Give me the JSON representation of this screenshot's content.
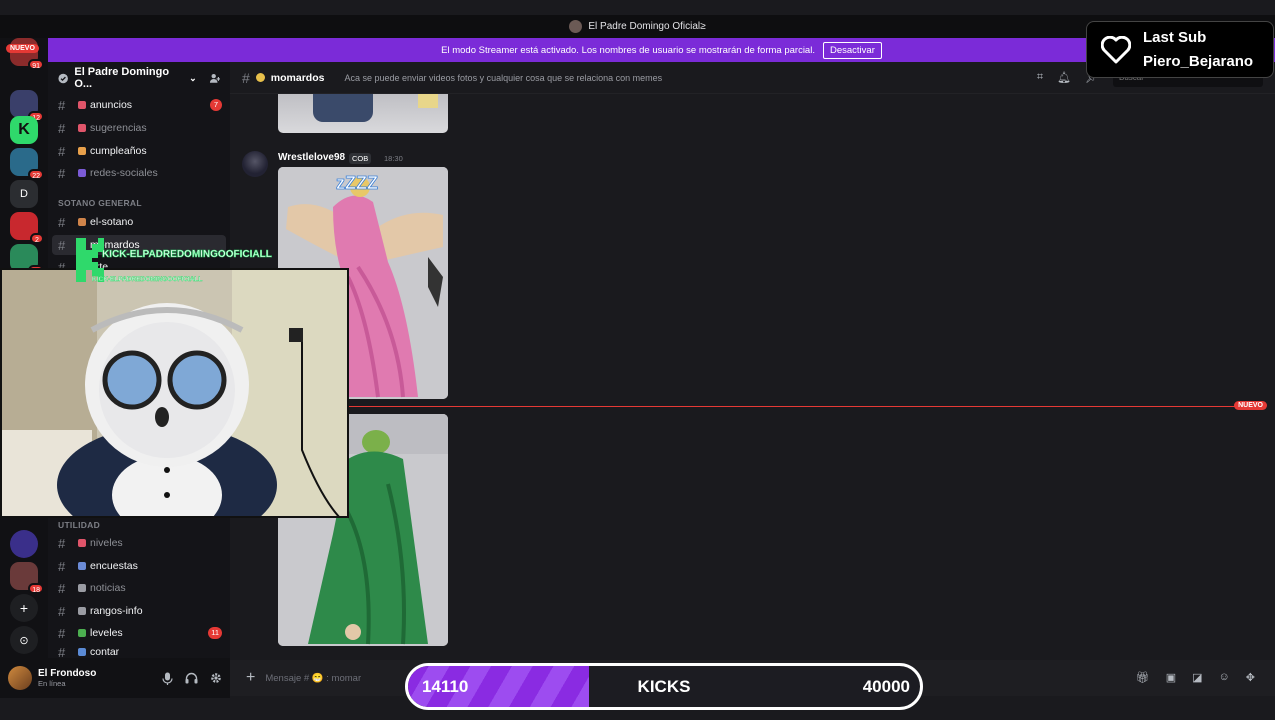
{
  "window": {
    "title": "El Padre Domingo Oficial≥"
  },
  "banner": {
    "text": "El modo Streamer está activado. Los nombres de usuario se mostrarán de forma parcial.",
    "button": "Desactivar"
  },
  "rail": {
    "top_badge": "NUEVO",
    "items": [
      {
        "label": "",
        "badge": "91"
      },
      {
        "label": "",
        "badge": "12"
      },
      {
        "label": "K",
        "badge": ""
      },
      {
        "label": "",
        "badge": "22"
      },
      {
        "label": "D",
        "badge": ""
      },
      {
        "label": "",
        "badge": "2"
      },
      {
        "label": "",
        "badge": "22"
      },
      {
        "label": "",
        "badge": ""
      },
      {
        "label": "",
        "badge": "18"
      },
      {
        "label": "+",
        "badge": ""
      },
      {
        "label": "⊙",
        "badge": ""
      }
    ]
  },
  "guild": {
    "name": "El Padre Domingo O..."
  },
  "channels": [
    {
      "name": "anuncios",
      "badge": "7",
      "color": "#e0556a",
      "unread": true
    },
    {
      "name": "sugerencias",
      "badge": "",
      "color": "#e0556a",
      "unread": false
    },
    {
      "name": "cumpleaños",
      "badge": "",
      "color": "#e8a04b",
      "unread": true
    },
    {
      "name": "redes-sociales",
      "badge": "",
      "color": "#7b5bd6",
      "unread": false
    }
  ],
  "category_general": "SOTANO GENERAL",
  "channels_general": [
    {
      "name": "el-sotano",
      "color": "#d0844a",
      "unread": true
    },
    {
      "name": "momardos",
      "color": "#e8c04b",
      "selected": true
    },
    {
      "name": "arte",
      "color": "#5bb0d6",
      "unread": true
    }
  ],
  "category_util": "UTILIDAD",
  "channels_util": [
    {
      "name": "niveles",
      "badge": "",
      "color": "#e0556a",
      "unread": false
    },
    {
      "name": "encuestas",
      "badge": "",
      "color": "#6b8bd6",
      "unread": true
    },
    {
      "name": "noticias",
      "badge": "",
      "color": "#9a9ca3",
      "unread": false
    },
    {
      "name": "rangos-info",
      "badge": "",
      "color": "#9a9ca3",
      "unread": true
    },
    {
      "name": "leveles",
      "badge": "11",
      "color": "#4caf50",
      "unread": true
    },
    {
      "name": "contar",
      "badge": "",
      "color": "#5b8bd6",
      "unread": true
    }
  ],
  "user": {
    "name": "El Frondoso",
    "status": "En línea"
  },
  "channel_header": {
    "name": "momardos",
    "topic": "Aca se puede enviar videos fotos y cualquier cosa que se relaciona con memes",
    "search_placeholder": "Buscar"
  },
  "message": {
    "author": "Wrestlelove98",
    "tag": "COB",
    "time": "18:30"
  },
  "divider": {
    "label": "NUEVO"
  },
  "composer": {
    "placeholder": "Mensaje # 😁 : momar"
  },
  "last_sub": {
    "title": "Last Sub",
    "name": "Piero_Bejarano"
  },
  "kick_watermark": {
    "text": "KICK-ELPADREDOMINGOOFICIALL"
  },
  "goal_bar": {
    "current": "14110",
    "label": "KICKS",
    "target": "40000",
    "progress": 0.3527
  }
}
